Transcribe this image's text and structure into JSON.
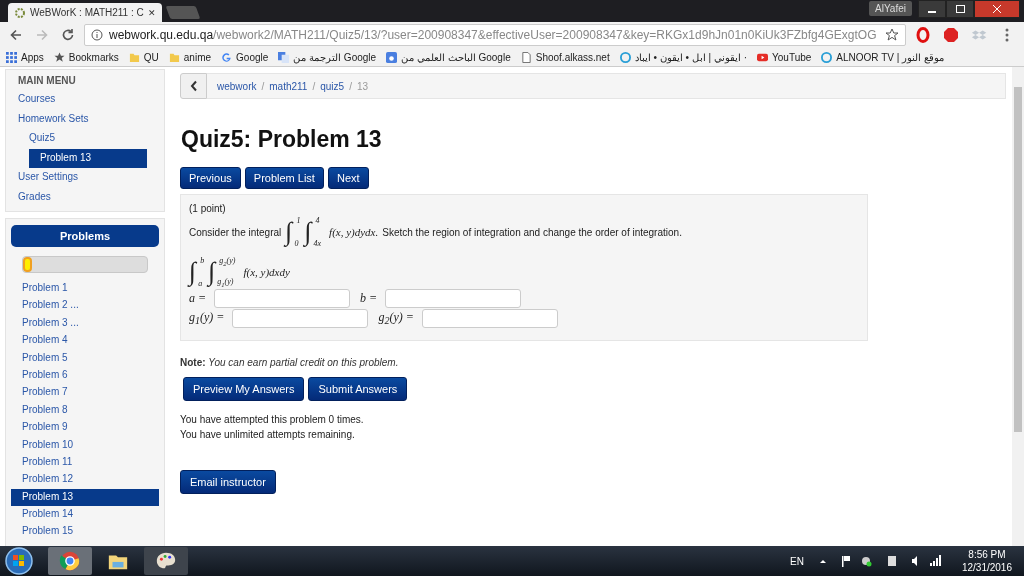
{
  "browser": {
    "tab_title": "WeBWorK : MATH211 : C",
    "tab_close": "✕",
    "user": "AlYafei",
    "url_host": "webwork.qu.edu.qa",
    "url_path": "/webwork2/MATH211/Quiz5/13/?user=200908347&effectiveUser=200908347&key=RKGx1d9hJn01n0KiUk3FZbfg4GExgtOG",
    "bookmarks": [
      {
        "label": "Apps",
        "kind": "apps"
      },
      {
        "label": "Bookmarks",
        "kind": "star"
      },
      {
        "label": "QU",
        "kind": "folder"
      },
      {
        "label": "anime",
        "kind": "folder"
      },
      {
        "label": "Google",
        "kind": "google"
      },
      {
        "label": "الترجمة من Google",
        "kind": "translate"
      },
      {
        "label": "الباحث العلمي من Google",
        "kind": "scholar"
      },
      {
        "label": "Shoof.alkass.net",
        "kind": "page"
      },
      {
        "label": "ايقوني | ابل • ايقون • ايباد ·",
        "kind": "circle"
      },
      {
        "label": "YouTube",
        "kind": "youtube"
      },
      {
        "label": "ALNOOR TV | موقع النور",
        "kind": "circle"
      }
    ]
  },
  "main_menu": {
    "title": "MAIN MENU",
    "items": [
      {
        "label": "Courses",
        "selected": false
      },
      {
        "label": "Homework Sets",
        "selected": false,
        "children": [
          {
            "label": "Quiz5",
            "selected": false,
            "children": [
              {
                "label": "Problem 13",
                "selected": true
              }
            ]
          }
        ]
      },
      {
        "label": "User Settings",
        "selected": false
      },
      {
        "label": "Grades",
        "selected": false
      }
    ]
  },
  "problems_panel": {
    "title": "Problems",
    "progress": {
      "level": 0.07
    },
    "items": [
      {
        "label": "Problem 1",
        "selected": false
      },
      {
        "label": "Problem 2 ...",
        "selected": false
      },
      {
        "label": "Problem 3 ...",
        "selected": false
      },
      {
        "label": "Problem 4",
        "selected": false
      },
      {
        "label": "Problem 5",
        "selected": false
      },
      {
        "label": "Problem 6",
        "selected": false
      },
      {
        "label": "Problem 7",
        "selected": false
      },
      {
        "label": "Problem 8",
        "selected": false
      },
      {
        "label": "Problem 9",
        "selected": false
      },
      {
        "label": "Problem 10",
        "selected": false
      },
      {
        "label": "Problem 11",
        "selected": false
      },
      {
        "label": "Problem 12",
        "selected": false
      },
      {
        "label": "Problem 13",
        "selected": true
      },
      {
        "label": "Problem 14",
        "selected": false
      },
      {
        "label": "Problem 15",
        "selected": false
      }
    ]
  },
  "breadcrumb": {
    "items": [
      "webwork",
      "math211",
      "quiz5",
      "13"
    ],
    "separators": [
      "/",
      "/",
      "/"
    ]
  },
  "title": "Quiz5: Problem 13",
  "nav_buttons": [
    "Previous",
    "Problem List",
    "Next"
  ],
  "problem": {
    "points": "(1 point)",
    "lead": "Consider the integral",
    "given": {
      "integrals": [
        {
          "symbol": "∫",
          "lower": "0",
          "upper": "1"
        },
        {
          "symbol": "∫",
          "lower": "4x",
          "upper": "4"
        }
      ],
      "integrand": "f(x, y)dydx."
    },
    "tail": "Sketch the region of integration and change the order of integration.",
    "answer_form": {
      "integrals": [
        {
          "symbol": "∫",
          "lower": "a",
          "upper": "b"
        },
        {
          "symbol": "∫",
          "lower": "g$_{1}$(y)",
          "upper": "g$_{2}$(y)"
        }
      ],
      "integrand": "f(x, y)dxdy"
    },
    "fields": [
      [
        {
          "label": "a ="
        },
        {
          "label": "b ="
        }
      ],
      [
        {
          "label": "g$_{1}$(y) ="
        },
        {
          "label": "g$_{2}$(y) ="
        }
      ]
    ]
  },
  "note": {
    "label": "Note:",
    "text": "You can earn partial credit on this problem."
  },
  "submit_buttons": [
    "Preview My Answers",
    "Submit Answers"
  ],
  "attempts": [
    "You have attempted this problem 0 times.",
    "You have unlimited attempts remaining."
  ],
  "email_button": "Email instructor",
  "taskbar": {
    "language": "EN",
    "time": "8:56 PM",
    "date": "12/31/2016"
  }
}
